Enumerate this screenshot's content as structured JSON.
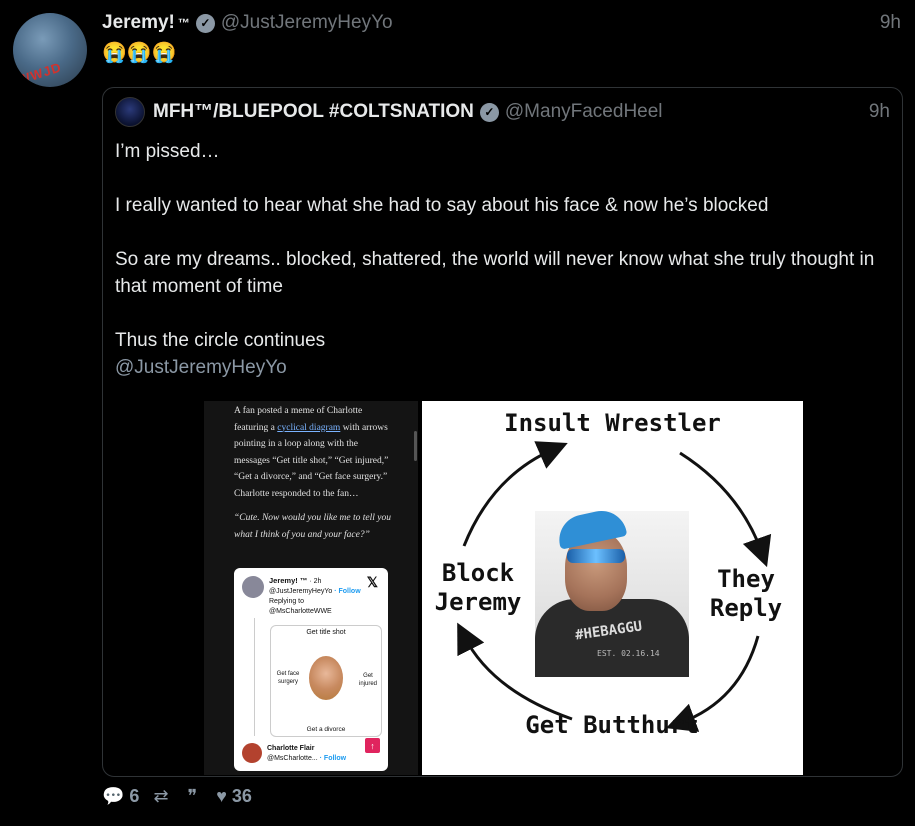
{
  "tweet": {
    "name": "Jeremy!",
    "tm": "™",
    "handle": "@JustJeremyHeyYo",
    "time": "9h",
    "text": "😭😭😭",
    "avatar_stamp": "WWJD"
  },
  "quote": {
    "name": "MFH™/BLUEPOOL #COLTSNATION",
    "handle": "@ManyFacedHeel",
    "time": "9h",
    "lines": [
      "I’m pissed…",
      "I really wanted to hear what she had to say about his face & now he’s blocked",
      "So are my dreams.. blocked, shattered, the world will never know what she truly thought in that moment of time",
      "Thus the circle continues"
    ],
    "mention": "@JustJeremyHeyYo"
  },
  "screenshot_left": {
    "para1_a": "A fan posted a meme of Charlotte featuring a ",
    "para1_link": "cyclical diagram",
    "para1_b": " with arrows pointing in a loop along with the messages “Get title shot,” “Get injured,” “Get a divorce,” and “Get face surgery.” Charlotte responded to the fan…",
    "quote": "“Cute. Now would you like me to tell you what I think of you and your face?”",
    "embed": {
      "name": "Jeremy! ™",
      "time": "· 2h",
      "handle": "@JustJeremyHeyYo",
      "follow": "· Follow",
      "replying_to": "Replying to",
      "reply_handle": "@MsCharlotteWWE",
      "diag_top": "Get title shot",
      "diag_left": "Get face surgery",
      "diag_right": "Get injured",
      "diag_bottom": "Get a divorce",
      "x_icon": "𝕏",
      "reply_name": "Charlotte Flair",
      "reply_handle2": "@MsCharlotte...",
      "reply_follow": "· Follow"
    }
  },
  "meme": {
    "top": "Insult Wrestler",
    "right": "They Reply",
    "bottom": "Get Butthurt",
    "left": "Block Jeremy",
    "shirt_text": "#HEBAGGU",
    "shirt_est": "EST. 02.16.14"
  },
  "actions": {
    "replies": "6",
    "retweets": "",
    "quotes": "",
    "likes": "36"
  },
  "colors": {
    "background": "#000000",
    "text": "#e7e9ea",
    "muted": "#71767b",
    "border": "#2f3336"
  }
}
